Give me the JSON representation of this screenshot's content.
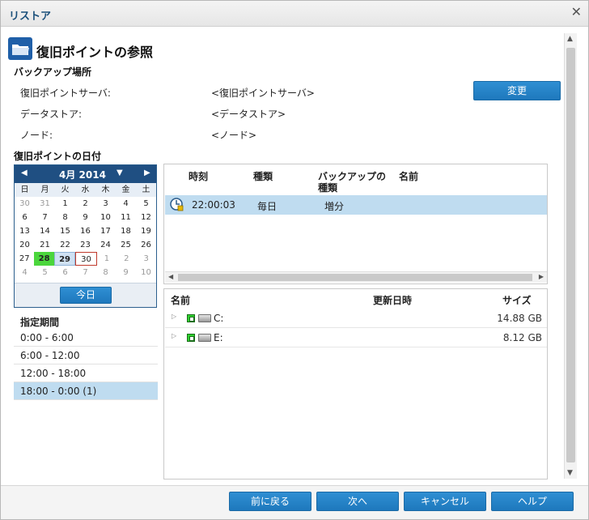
{
  "window": {
    "title": "リストア"
  },
  "page": {
    "title": "復旧ポイントの参照"
  },
  "backup_location": {
    "section_title": "バックアップ場所",
    "rows": [
      {
        "label": "復旧ポイントサーバ:",
        "value": "<復旧ポイントサーバ>"
      },
      {
        "label": "データストア:",
        "value": "<データストア>"
      },
      {
        "label": "ノード:",
        "value": "<ノード>"
      }
    ],
    "change_button": "変更"
  },
  "date_section": {
    "title": "復旧ポイントの日付"
  },
  "calendar": {
    "month_label": "4月 2014",
    "weekdays": [
      "日",
      "月",
      "火",
      "水",
      "木",
      "金",
      "土"
    ],
    "weeks": [
      [
        "30",
        "31",
        "1",
        "2",
        "3",
        "4",
        "5"
      ],
      [
        "6",
        "7",
        "8",
        "9",
        "10",
        "11",
        "12"
      ],
      [
        "13",
        "14",
        "15",
        "16",
        "17",
        "18",
        "19"
      ],
      [
        "20",
        "21",
        "22",
        "23",
        "24",
        "25",
        "26"
      ],
      [
        "27",
        "28",
        "29",
        "30",
        "1",
        "2",
        "3"
      ],
      [
        "4",
        "5",
        "6",
        "7",
        "8",
        "9",
        "10"
      ]
    ],
    "today_button": "今日"
  },
  "period": {
    "title": "指定期間",
    "items": [
      "0:00 - 6:00",
      "6:00 - 12:00",
      "12:00 - 18:00",
      "18:00 - 0:00 (1)"
    ]
  },
  "recovery_points": {
    "headers": {
      "time": "時刻",
      "type": "種類",
      "backup_type_line1": "バックアップの",
      "backup_type_line2": "種類",
      "name": "名前"
    },
    "rows": [
      {
        "time": "22:00:03",
        "type": "毎日",
        "backup_type": "増分",
        "name": ""
      }
    ]
  },
  "files": {
    "headers": {
      "name": "名前",
      "modified": "更新日時",
      "size": "サイズ"
    },
    "rows": [
      {
        "name": "C:",
        "modified": "",
        "size": "14.88 GB"
      },
      {
        "name": "E:",
        "modified": "",
        "size": "8.12 GB"
      }
    ]
  },
  "footer": {
    "back": "前に戻る",
    "next": "次へ",
    "cancel": "キャンセル",
    "help": "ヘルプ"
  },
  "colors": {
    "accent": "#1e78bd",
    "selection": "#bfdcf0",
    "calendar_header": "#1f4f82",
    "recovery_day": "#4bd63c"
  }
}
